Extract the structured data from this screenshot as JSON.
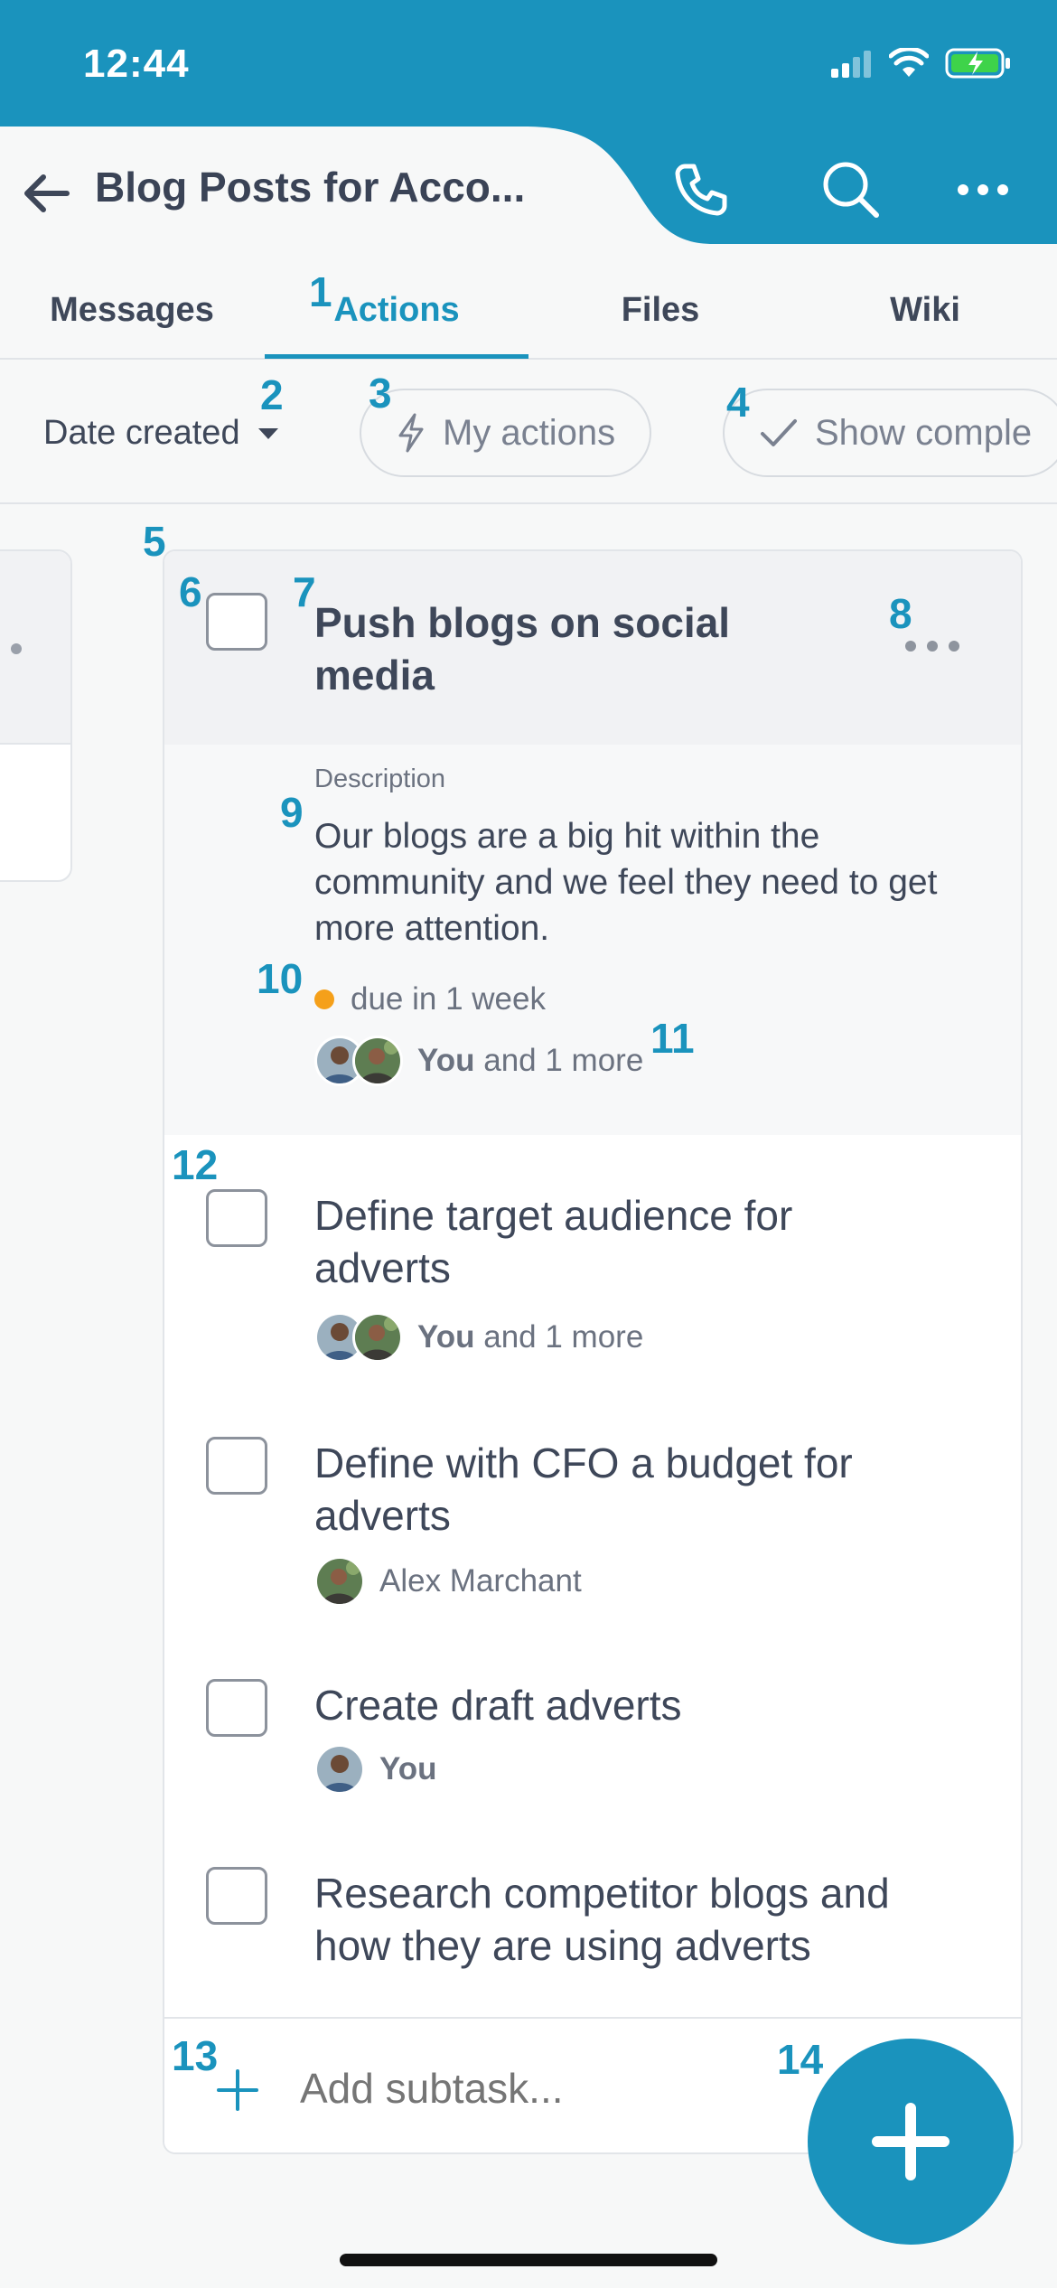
{
  "status_bar": {
    "time": "12:44"
  },
  "header": {
    "title": "Blog Posts for Acco..."
  },
  "tabs": [
    {
      "label": "Messages"
    },
    {
      "label": "Actions"
    },
    {
      "label": "Files"
    },
    {
      "label": "Wiki"
    }
  ],
  "filters": {
    "sort_label": "Date created",
    "my_actions_label": "My actions",
    "show_completed_label": "Show comple"
  },
  "expanded_task": {
    "title": "Push blogs on social media",
    "description_label": "Description",
    "description": "Our blogs are a big hit within the community and we feel they need to get more attention.",
    "due": "due in 1 week",
    "assignee_you": "You",
    "assignee_more": "and 1 more"
  },
  "subtasks": [
    {
      "title": "Define target audience for adverts",
      "assignee_bold": "You",
      "assignee_rest": "and 1 more"
    },
    {
      "title": "Define with CFO a budget for adverts",
      "assignee_bold": "",
      "assignee_rest": "Alex Marchant"
    },
    {
      "title": "Create draft adverts",
      "assignee_bold": "You",
      "assignee_rest": ""
    },
    {
      "title": "Research competitor blogs and how they are using adverts",
      "assignee_bold": "",
      "assignee_rest": ""
    }
  ],
  "add_subtask": {
    "placeholder": "Add subtask..."
  },
  "annotations": [
    "1",
    "2",
    "3",
    "4",
    "5",
    "6",
    "7",
    "8",
    "9",
    "10",
    "11",
    "12",
    "13",
    "14"
  ],
  "colors": {
    "brand": "#1a93bd",
    "due_dot": "#f5a01a"
  }
}
